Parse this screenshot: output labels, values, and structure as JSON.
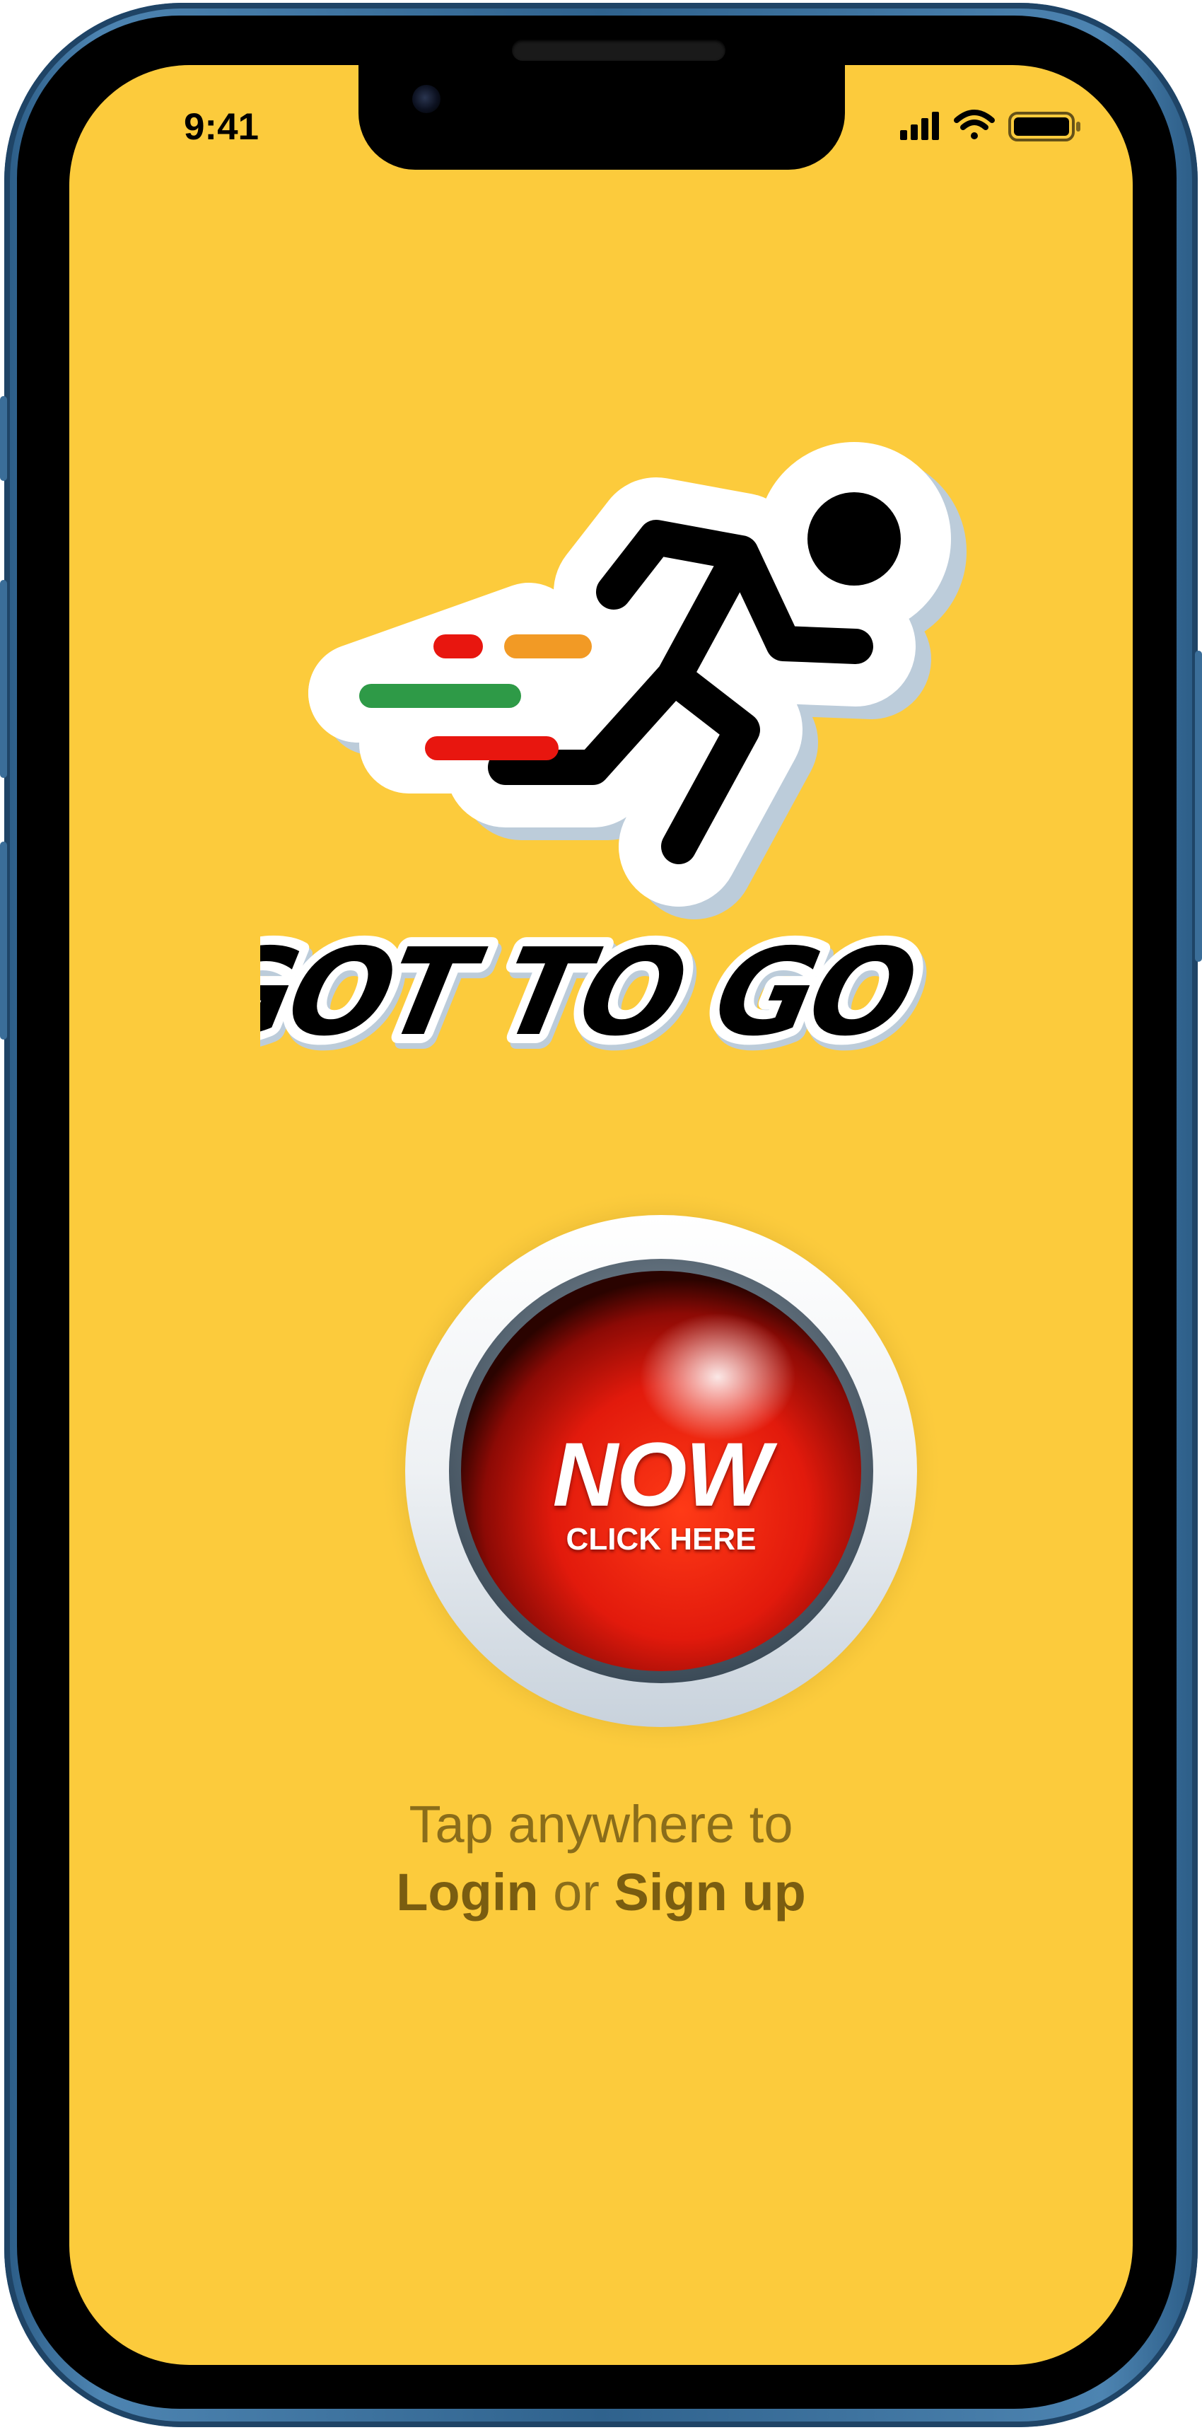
{
  "status_bar": {
    "time": "9:41",
    "icons": [
      "signal-icon",
      "wifi-icon",
      "battery-icon"
    ]
  },
  "logo": {
    "name": "GOT TO GO",
    "speed_line_colors": [
      "#e8160f",
      "#f29a25",
      "#2e9a47",
      "#e8160f"
    ]
  },
  "now_button": {
    "main_label": "NOW",
    "sub_label": "CLICK HERE"
  },
  "prompt": {
    "line1": "Tap anywhere to",
    "login": "Login",
    "connector": "or",
    "signup": "Sign up"
  },
  "colors": {
    "screen_background": "#fccb3c",
    "button_red": "#e21a0c",
    "text": "#8a6d1a",
    "frame": "#3b6e99"
  }
}
